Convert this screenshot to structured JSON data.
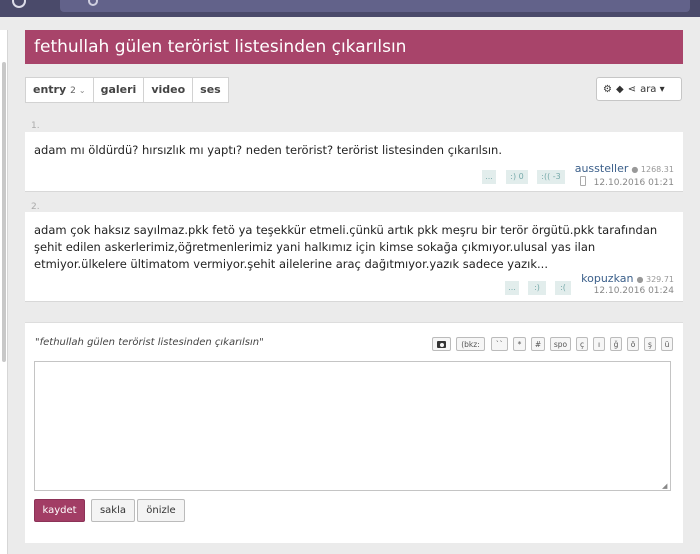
{
  "topic": {
    "title": "fethullah gülen terörist listesinden çıkarılsın"
  },
  "tabs": [
    {
      "label": "entry",
      "count": "2"
    },
    {
      "label": "galeri"
    },
    {
      "label": "video"
    },
    {
      "label": "ses"
    }
  ],
  "tools": {
    "search_label": "ara"
  },
  "entries": [
    {
      "number": "1.",
      "text": "adam mı öldürdü? hırsızlık mı yaptı? neden terörist? terörist listesinden çıkarılsın.",
      "author": "aussteller",
      "karma": "1268.31",
      "date": "12.10.2016 01:21",
      "votes": [
        "...",
        ":) 0",
        ":(( -3"
      ]
    },
    {
      "number": "2.",
      "text": "adam çok haksız sayılmaz.pkk fetö ya teşekkür etmeli.çünkü artık pkk meşru bir terör örgütü.pkk tarafından şehit edilen askerlerimiz,öğretmenlerimiz yani halkımız için kimse sokağa çıkmıyor.ulusal yas ilan etmiyor.ülkelere ültimatom vermiyor.şehit ailelerine araç dağıtmıyor.yazık sadece yazık...",
      "author": "kopuzkan",
      "karma": "329.71",
      "date": "12.10.2016 01:24",
      "votes": [
        "...",
        ":)",
        ":("
      ]
    }
  ],
  "editor": {
    "quote": "\"fethullah gülen terörist listesinden çıkarılsın\"",
    "format_buttons": [
      "(bkz:",
      "``",
      "*",
      "#",
      "spo",
      "ç",
      "ı",
      "ğ",
      "ö",
      "ş",
      "ü"
    ],
    "save_label": "kaydet",
    "hide_label": "sakla",
    "preview_label": "önizle"
  }
}
